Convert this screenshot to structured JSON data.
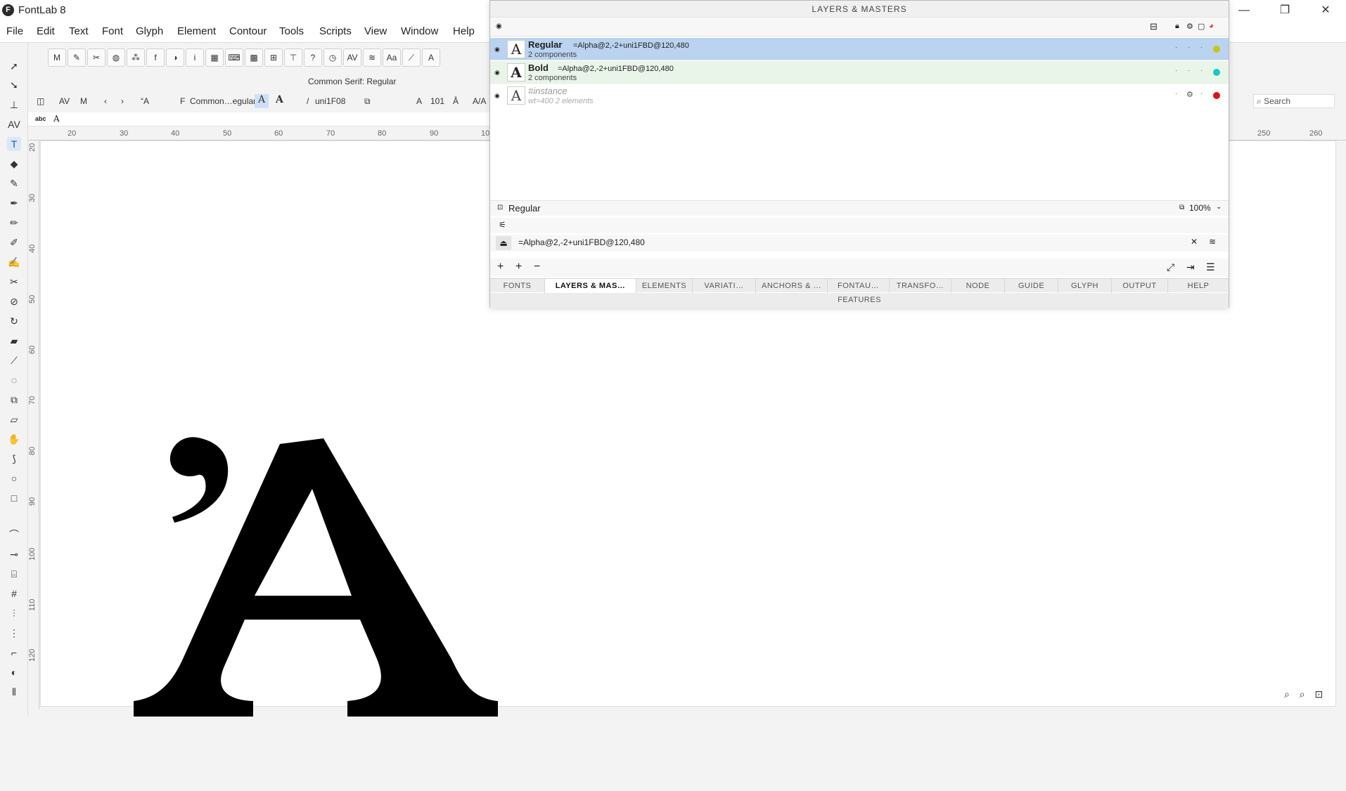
{
  "window": {
    "app_title": "FontLab 8",
    "logo_letter": "F",
    "minimize": "—",
    "maximize": "❐",
    "close": "✕"
  },
  "menu": [
    "File",
    "Edit",
    "Text",
    "Font",
    "Glyph",
    "Element",
    "Contour",
    "Tools",
    "Scripts",
    "View",
    "Window",
    "Help"
  ],
  "doc_title": "Common Serif: Regular",
  "toolbar2": {
    "font_name": "Common…egular",
    "glyph_name": "uni1F08",
    "size_value": "101",
    "quote_glyph": "“A",
    "text_a_1": "A",
    "text_a_2": "A"
  },
  "text_line": {
    "abc_label": "abc",
    "text": "A"
  },
  "ruler_h_ticks": [
    "20",
    "30",
    "40",
    "50",
    "60",
    "70",
    "80",
    "90",
    "10"
  ],
  "ruler_h_right_ticks": [
    "250",
    "260"
  ],
  "ruler_v_ticks": [
    "20",
    "30",
    "40",
    "50",
    "60",
    "70",
    "80",
    "90",
    "100",
    "110",
    "120"
  ],
  "search_placeholder": "Search",
  "glyph_char": "Ἀ",
  "panel": {
    "title": "LAYERS & MASTERS",
    "layers": [
      {
        "name": "Regular",
        "formula": "=Alpha@2,-2+uni1FBD@120,480",
        "sub": "2 components",
        "dot_color": "#c7c711",
        "selected": true
      },
      {
        "name": "Bold",
        "formula": "=Alpha@2,-2+uni1FBD@120,480",
        "sub": "2 components",
        "dot_color": "#19c7c7",
        "selected": false
      },
      {
        "name": "#instance",
        "formula": "",
        "sub": "wt=400  2 elements",
        "dot_color": "#e01010",
        "selected": false
      }
    ],
    "layer_name_field": "Regular",
    "opacity": "100%",
    "formula_field": "=Alpha@2,-2+uni1FBD@120,480",
    "tabs": [
      "FONTS",
      "LAYERS & MAS…",
      "ELEMENTS",
      "VARIATI…",
      "ANCHORS & …",
      "FONTAU…",
      "TRANSFO…",
      "NODE",
      "GUIDE",
      "GLYPH",
      "OUTPUT",
      "HELP"
    ],
    "active_tab_index": 1,
    "features_label": "FEATURES"
  },
  "colors": {
    "selected_row": "#b9d3f0",
    "bold_row": "#eaf5ea",
    "accent": "#1a56b0"
  }
}
